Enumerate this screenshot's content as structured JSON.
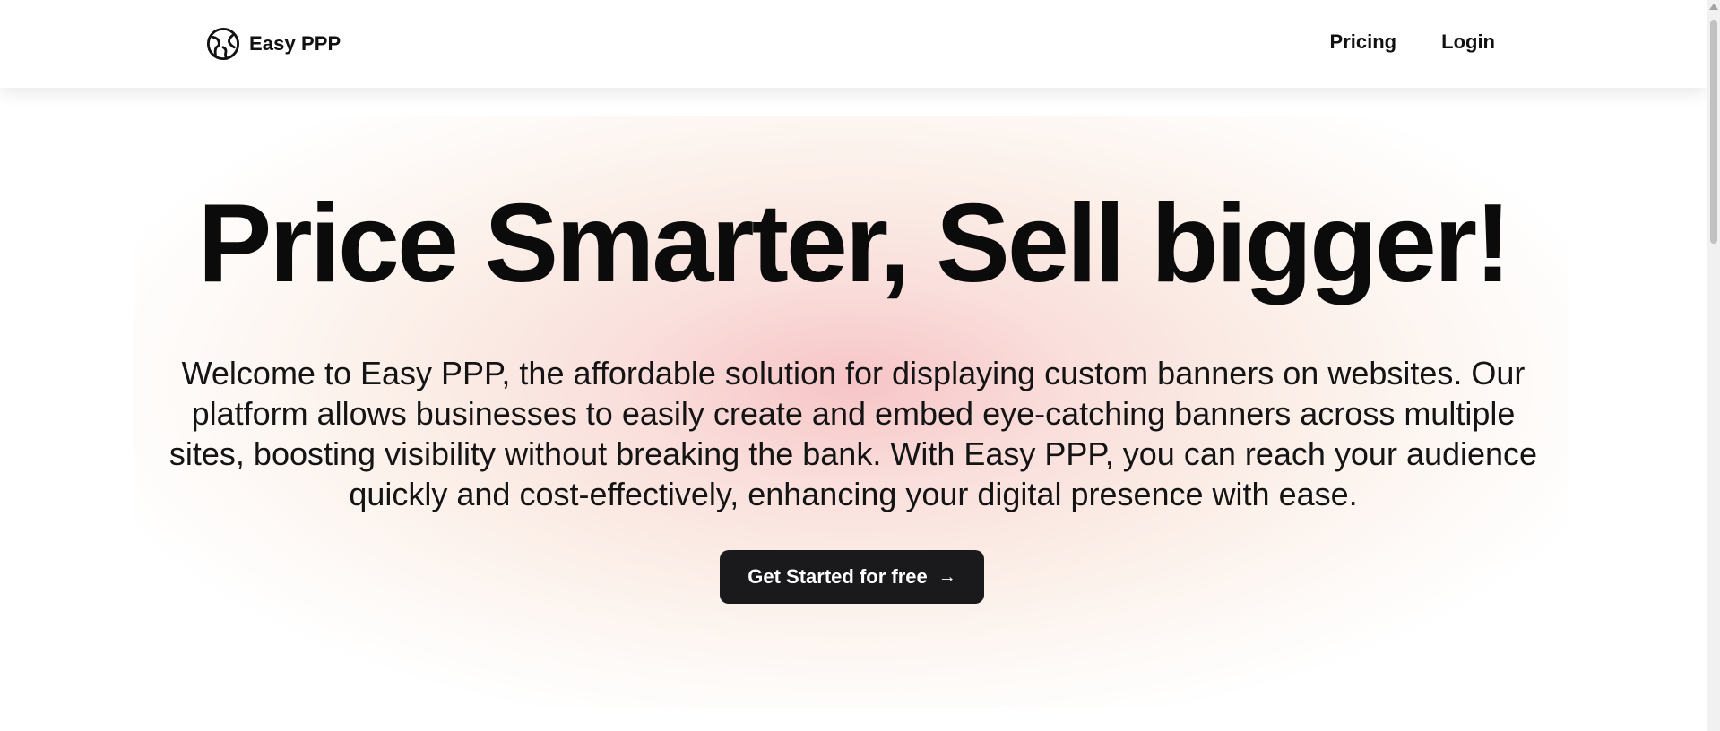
{
  "header": {
    "brand": {
      "name": "Easy PPP",
      "icon": "globe-logo-icon"
    },
    "nav": [
      {
        "label": "Pricing"
      },
      {
        "label": "Login"
      }
    ]
  },
  "hero": {
    "headline": "Price Smarter, Sell bigger!",
    "description": "Welcome to Easy PPP, the affordable solution for displaying custom banners on websites. Our platform allows businesses to easily create and embed eye-catching banners across multiple sites, boosting visibility without breaking the bank. With Easy PPP, you can reach your audience quickly and cost-effectively, enhancing your digital presence with ease.",
    "cta": {
      "label": "Get Started for free",
      "icon": "arrow-right-icon"
    }
  },
  "colors": {
    "text": "#0b0b0b",
    "cta_background": "#1a1a1c",
    "cta_text": "#ffffff",
    "glow_pink": "#f4b0b4",
    "glow_peach": "#f7dccd"
  }
}
